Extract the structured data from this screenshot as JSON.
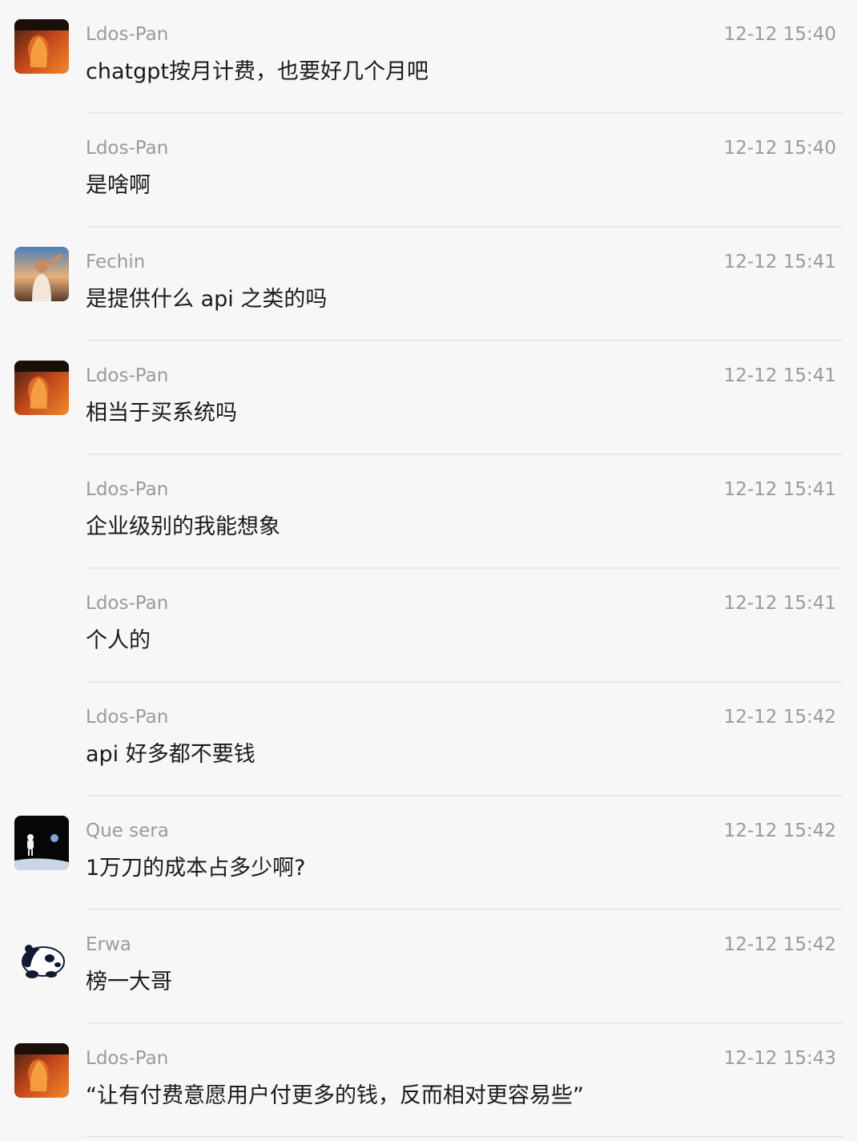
{
  "messages": [
    {
      "sender": "Ldos-Pan",
      "time": "12-12 15:40",
      "text": "chatgpt按月计费，也要好几个月吧",
      "avatar": "ldos"
    },
    {
      "sender": "Ldos-Pan",
      "time": "12-12 15:40",
      "text": "是啥啊",
      "avatar": ""
    },
    {
      "sender": "Fechin",
      "time": "12-12 15:41",
      "text": "是提供什么 api 之类的吗",
      "avatar": "fechin"
    },
    {
      "sender": "Ldos-Pan",
      "time": "12-12 15:41",
      "text": "相当于买系统吗",
      "avatar": "ldos"
    },
    {
      "sender": "Ldos-Pan",
      "time": "12-12 15:41",
      "text": "企业级别的我能想象",
      "avatar": ""
    },
    {
      "sender": "Ldos-Pan",
      "time": "12-12 15:41",
      "text": "个人的",
      "avatar": ""
    },
    {
      "sender": "Ldos-Pan",
      "time": "12-12 15:42",
      "text": "api 好多都不要钱",
      "avatar": ""
    },
    {
      "sender": "Que sera",
      "time": "12-12 15:42",
      "text": "1万刀的成本占多少啊?",
      "avatar": "quesera"
    },
    {
      "sender": "Erwa",
      "time": "12-12 15:42",
      "text": "榜一大哥",
      "avatar": "erwa"
    },
    {
      "sender": "Ldos-Pan",
      "time": "12-12 15:43",
      "text": "“让有付费意愿用户付更多的钱，反而相对更容易些”",
      "avatar": "ldos"
    }
  ],
  "colors": {
    "background": "#f7f7f7",
    "meta_text": "#9a9a9a",
    "body_text": "#1a1a1a",
    "divider": "#e8e8e8"
  }
}
